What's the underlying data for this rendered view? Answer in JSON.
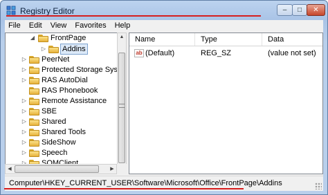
{
  "window": {
    "title": "Registry Editor",
    "controls": {
      "minimize": "–",
      "maximize": "□",
      "close": "✕"
    }
  },
  "menu": [
    "File",
    "Edit",
    "View",
    "Favorites",
    "Help"
  ],
  "tree": {
    "items": [
      {
        "label": "FrontPage",
        "arrow": "◢",
        "expanded": true
      },
      {
        "label": "Addins",
        "arrow": "▷",
        "selected": true
      },
      {
        "label": "PeerNet",
        "arrow": "▷"
      },
      {
        "label": "Protected Storage System I",
        "arrow": "▷"
      },
      {
        "label": "RAS AutoDial",
        "arrow": "▷"
      },
      {
        "label": "RAS Phonebook",
        "arrow": ""
      },
      {
        "label": "Remote Assistance",
        "arrow": "▷"
      },
      {
        "label": "SBE",
        "arrow": "▷"
      },
      {
        "label": "Shared",
        "arrow": "▷"
      },
      {
        "label": "Shared Tools",
        "arrow": "▷"
      },
      {
        "label": "SideShow",
        "arrow": "▷"
      },
      {
        "label": "Speech",
        "arrow": "▷"
      },
      {
        "label": "SQMClient",
        "arrow": "▷"
      }
    ]
  },
  "list": {
    "columns": [
      "Name",
      "Type",
      "Data"
    ],
    "rows": [
      {
        "name": "(Default)",
        "type": "REG_SZ",
        "data": "(value not set)",
        "icon": "ab-string-icon"
      }
    ]
  },
  "status": {
    "path": "Computer\\HKEY_CURRENT_USER\\Software\\Microsoft\\Office\\FrontPage\\Addins"
  },
  "colors": {
    "annotation_underline": "#d61d1d",
    "selection": "#dce9f8",
    "folder": "#e7b23b"
  }
}
